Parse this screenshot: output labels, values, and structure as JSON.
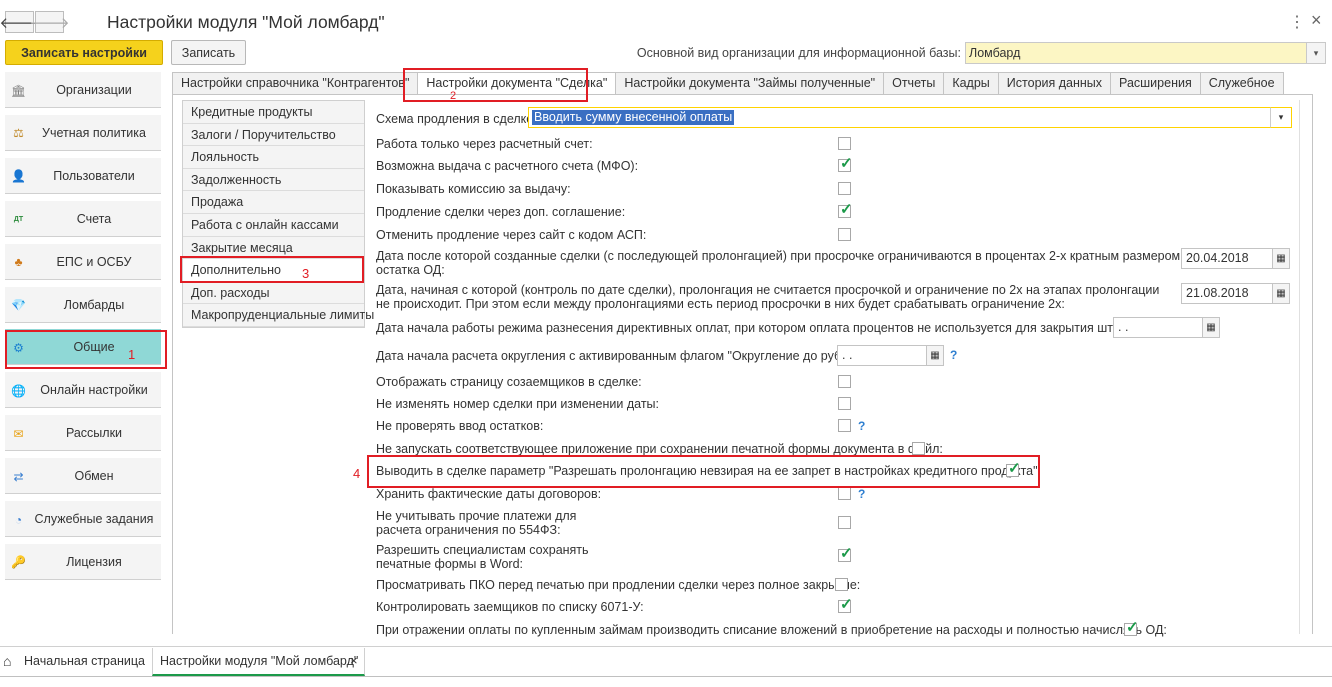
{
  "window": {
    "title": "Настройки модуля \"Мой ломбард\"",
    "back_icon": "arrow-left-icon",
    "forward_icon": "arrow-right-icon",
    "menu_icon": "more-vertical-icon",
    "close_icon": "close-icon",
    "back_glyph": "🡐",
    "forward_glyph": "🡒",
    "menu_glyph": "⋮",
    "close_glyph": "×"
  },
  "toolbar": {
    "save_settings": "Записать настройки",
    "save": "Записать",
    "org_kind_label": "Основной вид организации для информационной базы:",
    "org_kind_value": "Ломбард"
  },
  "sidebar": {
    "items": [
      {
        "label": "Организации",
        "icon": "bank-icon",
        "glyph": "🏛"
      },
      {
        "label": "Учетная политика",
        "icon": "scales-icon",
        "glyph": "⚖"
      },
      {
        "label": "Пользователи",
        "icon": "user-icon",
        "glyph": "👤"
      },
      {
        "label": "Счета",
        "icon": "accounts-icon",
        "glyph": "ДТ"
      },
      {
        "label": "ЕПС и ОСБУ",
        "icon": "tree-icon",
        "glyph": "♣"
      },
      {
        "label": "Ломбарды",
        "icon": "diamond-icon",
        "glyph": "💎"
      },
      {
        "label": "Общие",
        "icon": "gear-icon",
        "glyph": "⚙"
      },
      {
        "label": "Онлайн настройки",
        "icon": "globe-icon",
        "glyph": "🌐"
      },
      {
        "label": "Рассылки",
        "icon": "envelope-icon",
        "glyph": "✉"
      },
      {
        "label": "Обмен",
        "icon": "exchange-icon",
        "glyph": "⇄"
      },
      {
        "label": "Служебные задания",
        "icon": "clock-icon",
        "glyph": "◔"
      },
      {
        "label": "Лицензия",
        "icon": "key-icon",
        "glyph": "🔑"
      }
    ]
  },
  "tabs": [
    "Настройки справочника \"Контрагентов\"",
    "Настройки документа \"Сделка\"",
    "Настройки документа \"Займы полученные\"",
    "Отчеты",
    "Кадры",
    "История данных",
    "Расширения",
    "Служебное"
  ],
  "subnav": [
    "Кредитные продукты",
    "Залоги / Поручительство",
    "Лояльность",
    "Задолженность",
    "Продажа",
    "Работа с онлайн кассами",
    "Закрытие месяца",
    "Дополнительно",
    "Доп. расходы",
    "Макропруденциальные лимиты"
  ],
  "annotations": {
    "n1": "1",
    "n2": "2",
    "n3": "3",
    "n4": "4"
  },
  "form": {
    "scheme_label": "Схема продления в сделке:",
    "scheme_value": "Вводить сумму внесенной оплаты",
    "rows": [
      {
        "label": "Работа только через расчетный счет:",
        "checked": false
      },
      {
        "label": "Возможна выдача с расчетного счета (МФО):",
        "checked": true
      },
      {
        "label": "Показывать комиссию за выдачу:",
        "checked": false
      },
      {
        "label": "Продление сделки через доп. соглашение:",
        "checked": true
      },
      {
        "label": "Отменить продление через сайт с кодом АСП:",
        "checked": false
      }
    ],
    "date1_label": "Дата после которой созданные сделки (с последующей пролонгацией) при просрочке ограничиваются в процентах 2-х кратным размером остатка ОД:",
    "date1_value": "20.04.2018",
    "date2_label": "Дата, начиная с которой (контроль по дате сделки), пролонгация не считается просрочкой и ограничение по 2х на этапах пролонгации не происходит. При этом если между пролонгациями есть период просрочки в них будет срабатывать ограничение 2х:",
    "date2_value": "21.08.2018",
    "date3_label": "Дата начала работы режима разнесения директивных оплат, при котором оплата процентов не используется для закрытия штрафов:",
    "date3_value": ". .",
    "date4_label": "Дата начала расчета округления с активированным флагом \"Округление до рубля\":",
    "date4_value": ". .",
    "rows2": [
      {
        "label": "Отображать страницу созаемщиков в сделке:",
        "checked": false
      },
      {
        "label": "Не изменять номер сделки при изменении даты:",
        "checked": false
      },
      {
        "label": "Не проверять ввод остатков:",
        "checked": false
      },
      {
        "label": "Не запускать соответствующее приложение при сохранении печатной формы документа в файл:",
        "checked": false
      },
      {
        "label": "Выводить в сделке параметр \"Разрешать пролонгацию невзирая на ее запрет в настройках кредитного продукта\":",
        "checked": true
      },
      {
        "label": "Хранить фактические даты договоров:",
        "checked": false
      },
      {
        "label": "Не учитывать прочие платежи для расчета ограничения по 554ФЗ:",
        "checked": false
      },
      {
        "label": "Разрешить специалистам сохранять печатные формы в Word:",
        "checked": true
      },
      {
        "label": "Просматривать ПКО перед печатью при продлении сделки через полное закрытие:",
        "checked": false
      },
      {
        "label": "Контролировать заемщиков по списку 6071-У:",
        "checked": true
      },
      {
        "label": "При отражении оплаты по купленным займам производить списание вложений в приобретение на расходы и полностью начислять ОД:",
        "checked": true
      }
    ],
    "help": "?",
    "calendar_glyph": "▦",
    "dropdown_glyph": "▾"
  },
  "bottom": {
    "home_icon": "home-icon",
    "home_glyph": "⌂",
    "home": "Начальная страница",
    "tab": "Настройки модуля \"Мой ломбард\"",
    "close": "×"
  }
}
